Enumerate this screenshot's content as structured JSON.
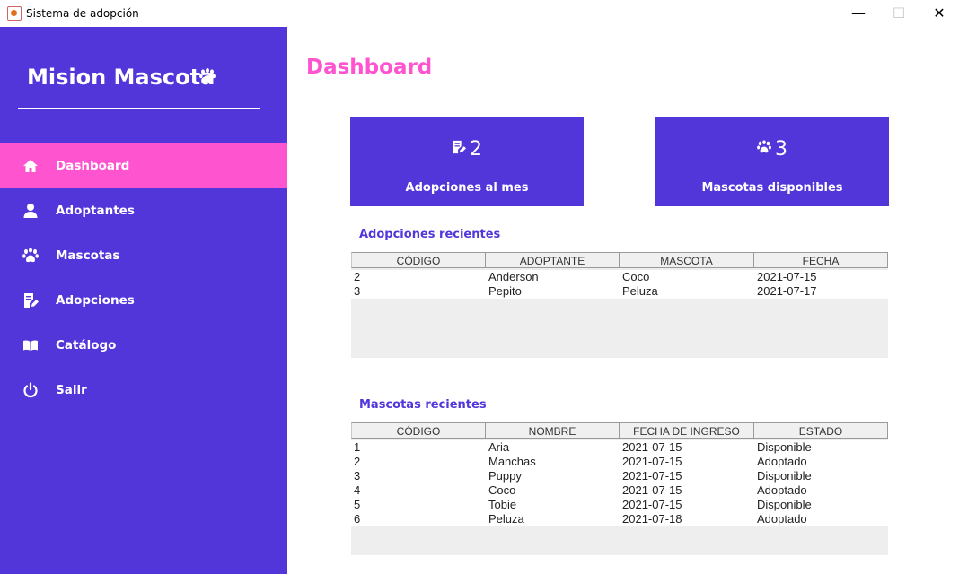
{
  "window": {
    "title": "Sistema de adopción",
    "minimize": "—",
    "maximize": "☐",
    "close": "✕"
  },
  "sidebar": {
    "brand": "Mision Mascota",
    "items": [
      {
        "label": "Dashboard",
        "icon": "home-icon",
        "active": true
      },
      {
        "label": "Adoptantes",
        "icon": "user-icon"
      },
      {
        "label": "Mascotas",
        "icon": "paw-icon"
      },
      {
        "label": "Adopciones",
        "icon": "edit-document-icon"
      },
      {
        "label": "Catálogo",
        "icon": "book-icon"
      },
      {
        "label": "Salir",
        "icon": "power-icon"
      }
    ]
  },
  "main": {
    "title": "Dashboard",
    "cards": [
      {
        "value": "2",
        "label": "Adopciones al mes",
        "icon": "edit-document-icon"
      },
      {
        "value": "3",
        "label": "Mascotas disponibles",
        "icon": "paw-icon"
      }
    ],
    "adoptions": {
      "title": "Adopciones recientes",
      "columns": [
        "CÓDIGO",
        "ADOPTANTE",
        "MASCOTA",
        "FECHA"
      ],
      "rows": [
        [
          "2",
          "Anderson",
          "Coco",
          "2021-07-15"
        ],
        [
          "3",
          "Pepito",
          "Peluza",
          "2021-07-17"
        ]
      ]
    },
    "pets": {
      "title": "Mascotas recientes",
      "columns": [
        "CÓDIGO",
        "NOMBRE",
        "FECHA DE INGRESO",
        "ESTADO"
      ],
      "rows": [
        [
          "1",
          "Aria",
          "2021-07-15",
          "Disponible"
        ],
        [
          "2",
          "Manchas",
          "2021-07-15",
          "Adoptado"
        ],
        [
          "3",
          "Puppy",
          "2021-07-15",
          "Disponible"
        ],
        [
          "4",
          "Coco",
          "2021-07-15",
          "Adoptado"
        ],
        [
          "5",
          "Tobie",
          "2021-07-15",
          "Disponible"
        ],
        [
          "6",
          "Peluza",
          "2021-07-18",
          "Adoptado"
        ]
      ]
    }
  },
  "colors": {
    "primary": "#5236d9",
    "accent": "#ff54cf"
  }
}
